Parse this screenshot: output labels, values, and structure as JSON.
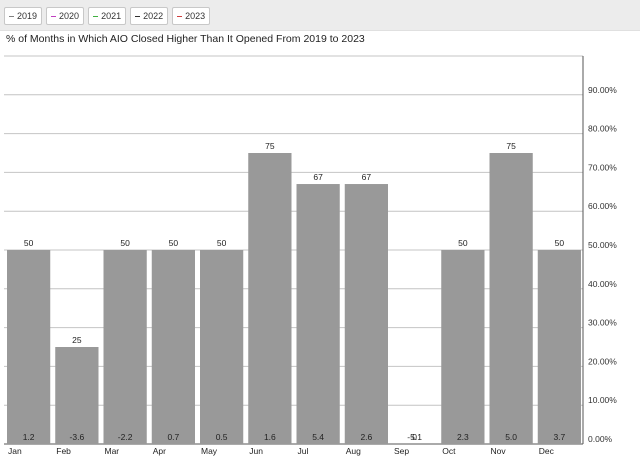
{
  "legend": [
    {
      "label": "2019",
      "color": "#808080"
    },
    {
      "label": "2020",
      "color": "#c040c0"
    },
    {
      "label": "2021",
      "color": "#40b040"
    },
    {
      "label": "2022",
      "color": "#303030"
    },
    {
      "label": "2023",
      "color": "#d04040"
    }
  ],
  "chart_data": {
    "type": "bar",
    "title": "% of Months in Which AIO Closed Higher Than It Opened From 2019 to 2023",
    "categories": [
      "Jan",
      "Feb",
      "Mar",
      "Apr",
      "May",
      "Jun",
      "Jul",
      "Aug",
      "Sep",
      "Oct",
      "Nov",
      "Dec"
    ],
    "values": [
      50,
      25,
      50,
      50,
      50,
      75,
      67,
      67,
      0,
      50,
      75,
      50
    ],
    "bottom_labels": [
      "1.2",
      "-3.6",
      "-2.2",
      "0.7",
      "0.5",
      "1.6",
      "5.4",
      "2.6",
      "-5.1",
      "2.3",
      "5.0",
      "3.7"
    ],
    "y_ticks": [
      "0.00%",
      "10.00%",
      "20.00%",
      "30.00%",
      "40.00%",
      "50.00%",
      "60.00%",
      "70.00%",
      "80.00%",
      "90.00%"
    ],
    "ylim": [
      0,
      100
    ],
    "y_axis_side": "right",
    "grid": true,
    "bar_color": "#999999"
  }
}
